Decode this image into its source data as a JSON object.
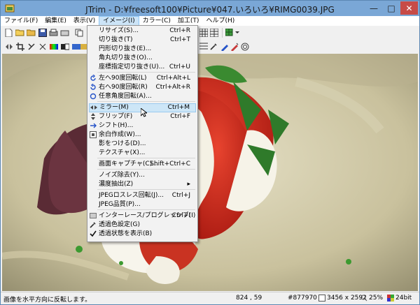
{
  "window": {
    "title": "JTrim - D:¥freesoft100¥Picture¥047.いろいろ¥RIMG0039.JPG"
  },
  "menubar": [
    "ファイル(F)",
    "編集(E)",
    "表示(V)",
    "イメージ(I)",
    "カラー(C)",
    "加工(T)",
    "ヘルプ(H)"
  ],
  "dropdown": {
    "items": [
      {
        "label": "リサイズ(S)...",
        "shortcut": "Ctrl+R"
      },
      {
        "label": "切り抜き(T)",
        "shortcut": "Ctrl+T"
      },
      {
        "label": "円形切り抜き(E)...",
        "shortcut": ""
      },
      {
        "label": "角丸切り抜き(O)...",
        "shortcut": ""
      },
      {
        "label": "座標指定切り抜き(U)...",
        "shortcut": "Ctrl+U"
      },
      {
        "label": "左へ90度回転(L)",
        "shortcut": "Ctrl+Alt+L"
      },
      {
        "label": "右へ90度回転(R)",
        "shortcut": "Ctrl+Alt+R"
      },
      {
        "label": "任意角度回転(A)...",
        "shortcut": ""
      },
      {
        "label": "ミラー(M)",
        "shortcut": "Ctrl+M"
      },
      {
        "label": "フリップ(F)",
        "shortcut": "Ctrl+F"
      },
      {
        "label": "シフト(H)...",
        "shortcut": ""
      },
      {
        "label": "余白作成(W)...",
        "shortcut": ""
      },
      {
        "label": "影をつける(D)...",
        "shortcut": ""
      },
      {
        "label": "テクスチャ(X)...",
        "shortcut": ""
      },
      {
        "label": "画面キャプチャ(C)...",
        "shortcut": "Shift+Ctrl+C"
      },
      {
        "label": "ノイズ除去(Y)...",
        "shortcut": ""
      },
      {
        "label": "濃度抽出(Z)",
        "shortcut": "▸"
      },
      {
        "label": "JPEGロスレス回転(J)...",
        "shortcut": "Ctrl+J"
      },
      {
        "label": "JPEG品質(P)...",
        "shortcut": ""
      },
      {
        "label": "インターレース/プログレッシブ(I)",
        "shortcut": "Ctrl+I"
      },
      {
        "label": "透過色設定(G)",
        "shortcut": ""
      },
      {
        "label": "透過状態を表示(B)",
        "shortcut": ""
      }
    ]
  },
  "status": {
    "message": "画像を水平方向に反転します。",
    "coords": "824 , 59",
    "color": "#877970",
    "dims": "3456 x 2592",
    "zoom": "25%",
    "depth": "24bit"
  },
  "colors": {
    "title": "#7aa7d6",
    "highlight": "#cde6f7"
  }
}
